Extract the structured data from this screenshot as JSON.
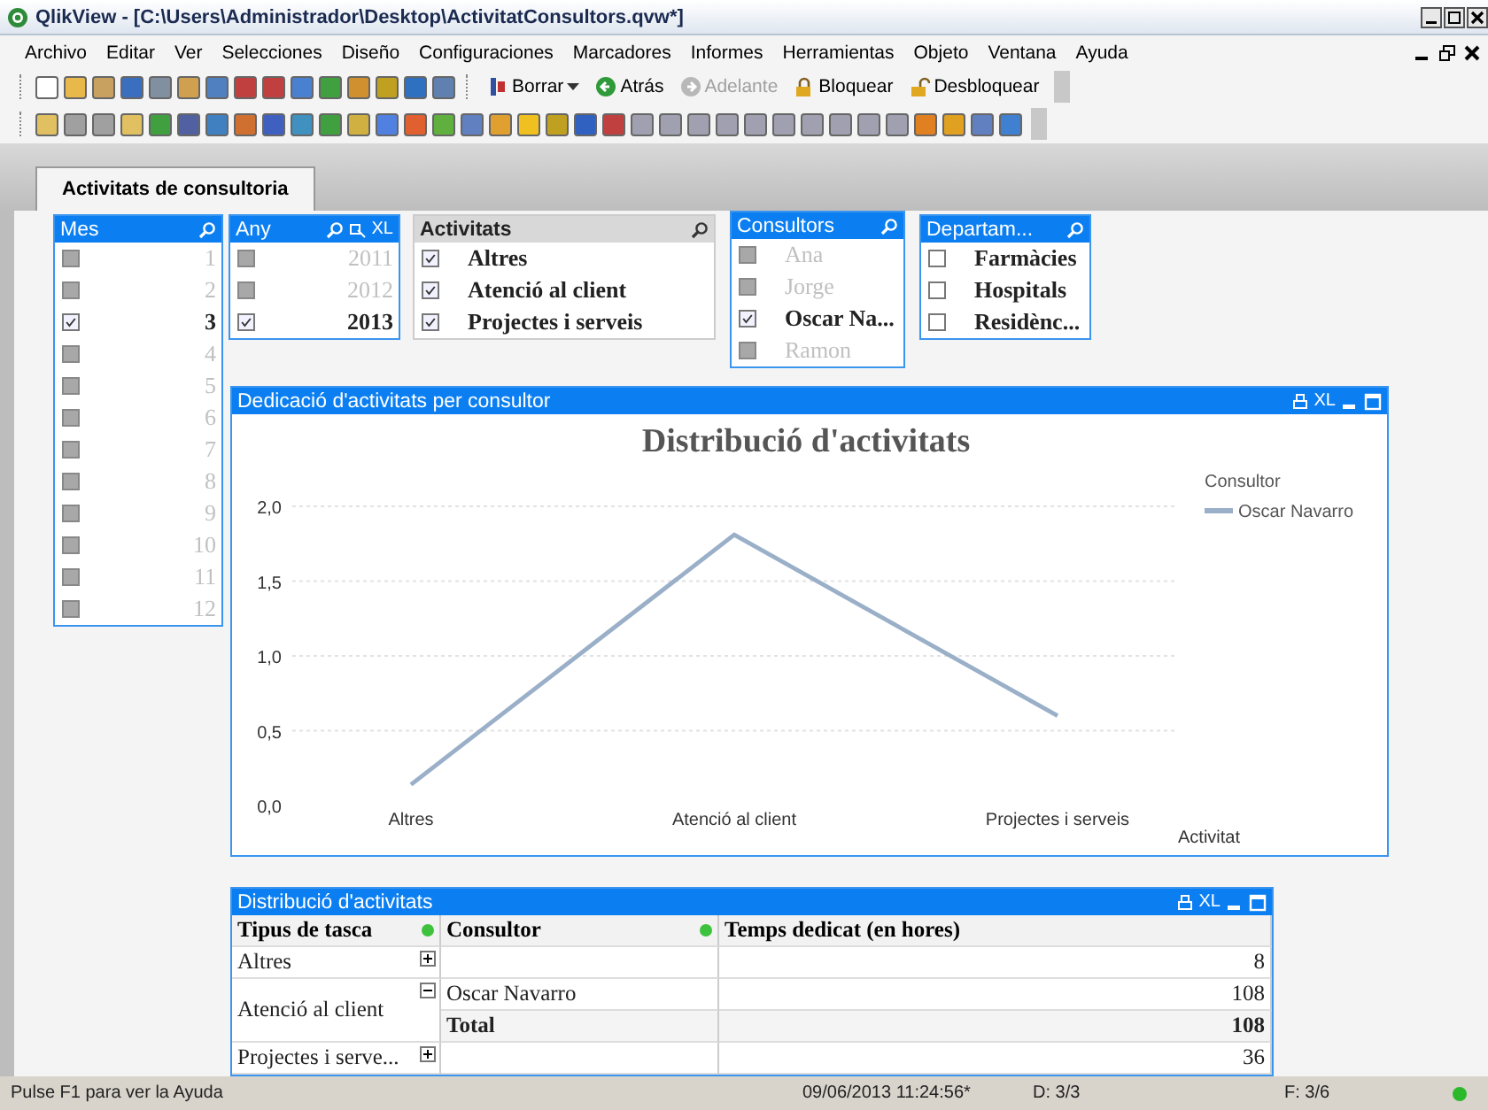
{
  "window": {
    "title": "QlikView - [C:\\Users\\Administrador\\Desktop\\ActivitatConsultors.qvw*]"
  },
  "menu": [
    "Archivo",
    "Editar",
    "Ver",
    "Selecciones",
    "Diseño",
    "Configuraciones",
    "Marcadores",
    "Informes",
    "Herramientas",
    "Objeto",
    "Ventana",
    "Ayuda"
  ],
  "toolbar": {
    "buttons": [
      {
        "label": "Borrar",
        "kind": "clear",
        "disabled": false
      },
      {
        "label": "Atrás",
        "kind": "back",
        "disabled": false
      },
      {
        "label": "Adelante",
        "kind": "forward",
        "disabled": true
      },
      {
        "label": "Bloquear",
        "kind": "lock",
        "disabled": false
      },
      {
        "label": "Desbloquear",
        "kind": "unlock",
        "disabled": false
      }
    ]
  },
  "tabs": [
    {
      "label": "Activitats de consultoria",
      "selected": true
    }
  ],
  "listboxes": [
    {
      "title": "Mes",
      "active": true,
      "kind": "number",
      "items": [
        {
          "label": "1",
          "selected": false,
          "excluded": true
        },
        {
          "label": "2",
          "selected": false,
          "excluded": true
        },
        {
          "label": "3",
          "selected": true,
          "excluded": false
        },
        {
          "label": "4",
          "selected": false,
          "excluded": true
        },
        {
          "label": "5",
          "selected": false,
          "excluded": true
        },
        {
          "label": "6",
          "selected": false,
          "excluded": true
        },
        {
          "label": "7",
          "selected": false,
          "excluded": true
        },
        {
          "label": "8",
          "selected": false,
          "excluded": true
        },
        {
          "label": "9",
          "selected": false,
          "excluded": true
        },
        {
          "label": "10",
          "selected": false,
          "excluded": true
        },
        {
          "label": "11",
          "selected": false,
          "excluded": true
        },
        {
          "label": "12",
          "selected": false,
          "excluded": true
        }
      ]
    },
    {
      "title": "Any",
      "active": true,
      "kind": "number",
      "header_text": "XL",
      "items": [
        {
          "label": "2011",
          "selected": false,
          "excluded": true
        },
        {
          "label": "2012",
          "selected": false,
          "excluded": true
        },
        {
          "label": "2013",
          "selected": true,
          "excluded": false
        }
      ]
    },
    {
      "title": "Activitats",
      "active": false,
      "kind": "text",
      "items": [
        {
          "label": "Altres",
          "selected": true,
          "excluded": false
        },
        {
          "label": "Atenció al client",
          "selected": true,
          "excluded": false
        },
        {
          "label": "Projectes i serveis",
          "selected": true,
          "excluded": false
        }
      ]
    },
    {
      "title": "Consultors",
      "active": true,
      "kind": "text",
      "items": [
        {
          "label": "Ana",
          "selected": false,
          "excluded": true
        },
        {
          "label": "Jorge",
          "selected": false,
          "excluded": true
        },
        {
          "label": "Oscar Na...",
          "selected": true,
          "excluded": false
        },
        {
          "label": "Ramon",
          "selected": false,
          "excluded": true
        }
      ]
    },
    {
      "title": "Departam...",
      "active": true,
      "kind": "text",
      "items": [
        {
          "label": "Farmàcies",
          "selected": false,
          "excluded": false
        },
        {
          "label": "Hospitals",
          "selected": false,
          "excluded": false
        },
        {
          "label": "Residènc...",
          "selected": false,
          "excluded": false
        }
      ]
    }
  ],
  "chart": {
    "title": "Dedicació d'activitats per consultor",
    "header_text": "XL",
    "legend_title": "Consultor",
    "chart_data": {
      "type": "line",
      "title": "Distribució d'activitats",
      "xlabel": "Activitat",
      "categories": [
        "Altres",
        "Atenció al client",
        "Projectes i serveis"
      ],
      "series": [
        {
          "name": "Oscar Navarro",
          "color": "#9aafc8",
          "values": [
            0.14,
            1.81,
            0.6
          ]
        }
      ],
      "ylim": [
        0,
        2
      ],
      "grid": true,
      "yticks": [
        {
          "value": 0,
          "label": "0,0"
        },
        {
          "value": 0.5,
          "label": "0,5"
        },
        {
          "value": 1,
          "label": "1,0"
        },
        {
          "value": 1.5,
          "label": "1,5"
        },
        {
          "value": 2,
          "label": "2,0"
        }
      ]
    }
  },
  "table": {
    "title": "Distribució d'activitats",
    "header_text": "XL",
    "columns": [
      {
        "label": "Tipus de tasca",
        "dot": true
      },
      {
        "label": "Consultor",
        "dot": true
      },
      {
        "label": "Temps dedicat (en hores)",
        "dot": false
      }
    ],
    "rows": [
      {
        "label": "Altres",
        "expanded": false,
        "value": "8"
      },
      {
        "label": "Atenció al client",
        "expanded": true,
        "children": [
          {
            "label": "Oscar Navarro",
            "kind": "detail",
            "value": "108"
          },
          {
            "label": "Total",
            "kind": "total",
            "value": "108"
          }
        ]
      },
      {
        "label": "Projectes i serve...",
        "expanded": false,
        "value": "36"
      }
    ]
  },
  "status_bar": {
    "hint": "Pulse F1 para ver la Ayuda",
    "timestamp": "09/06/2013 11:24:56*",
    "dimensions": "D: 3/3",
    "fields": "F: 3/6"
  }
}
